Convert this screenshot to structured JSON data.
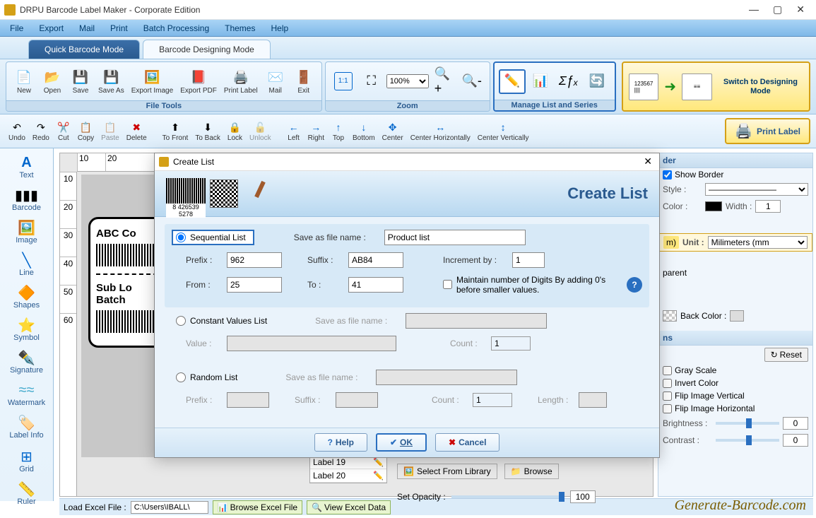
{
  "app": {
    "title": "DRPU Barcode Label Maker - Corporate Edition"
  },
  "menu": {
    "file": "File",
    "export": "Export",
    "mail": "Mail",
    "print": "Print",
    "batch": "Batch Processing",
    "themes": "Themes",
    "help": "Help"
  },
  "modes": {
    "quick": "Quick Barcode Mode",
    "designing": "Barcode Designing Mode"
  },
  "ribbon": {
    "file_tools": "File Tools",
    "new": "New",
    "open": "Open",
    "save": "Save",
    "save_as": "Save As",
    "export_image": "Export Image",
    "export_pdf": "Export PDF",
    "print_label": "Print Label",
    "mail": "Mail",
    "exit": "Exit",
    "zoom": "Zoom",
    "zoom_value": "100%",
    "manage": "Manage List and Series",
    "switch": "Switch to Designing Mode"
  },
  "toolbar2": {
    "undo": "Undo",
    "redo": "Redo",
    "cut": "Cut",
    "copy": "Copy",
    "paste": "Paste",
    "delete": "Delete",
    "to_front": "To Front",
    "to_back": "To Back",
    "lock": "Lock",
    "unlock": "Unlock",
    "left": "Left",
    "right": "Right",
    "top": "Top",
    "bottom": "Bottom",
    "center": "Center",
    "center_h": "Center Horizontally",
    "center_v": "Center Vertically",
    "print_label": "Print Label"
  },
  "palette": {
    "text": "Text",
    "barcode": "Barcode",
    "image": "Image",
    "line": "Line",
    "shapes": "Shapes",
    "symbol": "Symbol",
    "signature": "Signature",
    "watermark": "Watermark",
    "label_info": "Label Info",
    "grid": "Grid",
    "ruler": "Ruler"
  },
  "ruler_h": [
    "10",
    "20"
  ],
  "ruler_v": [
    "10",
    "20",
    "30",
    "40",
    "50",
    "60"
  ],
  "label": {
    "title": "ABC Co",
    "sub1": "Sub Lo",
    "sub2": "Batch"
  },
  "right": {
    "border_hdr": "der",
    "show_border": "Show Border",
    "style": "Style :",
    "color": "Color :",
    "width": "Width :",
    "width_val": "1",
    "unit_lbl": "Unit :",
    "unit_val": "Milimeters (mm",
    "parent": "parent",
    "back_color": "Back Color :",
    "options_hdr": "ns",
    "reset": "Reset",
    "gray_scale": "Gray Scale",
    "invert_color": "Invert Color",
    "flip_v": "Flip Image Vertical",
    "flip_h": "Flip Image Horizontal",
    "brightness": "Brightness :",
    "brightness_val": "0",
    "contrast": "Contrast :",
    "contrast_val": "0"
  },
  "label_list": [
    "Label 19",
    "Label 20"
  ],
  "lib_row": {
    "select": "Select From Library",
    "browse": "Browse"
  },
  "opacity": {
    "label": "Set Opacity :",
    "value": "100"
  },
  "bottom": {
    "load_excel": "Load Excel File :",
    "path": "C:\\Users\\IBALL\\",
    "browse": "Browse Excel File",
    "view": "View Excel Data"
  },
  "watermark": "Generate-Barcode.com",
  "dialog": {
    "title": "Create List",
    "header": "Create List",
    "hdr_bc_num": "8 426539 5278",
    "seq": "Sequential List",
    "save_as": "Save as file name :",
    "save_val": "Product list",
    "prefix_lbl": "Prefix :",
    "prefix_val": "962",
    "suffix_lbl": "Suffix :",
    "suffix_val": "AB84",
    "increment_lbl": "Increment by :",
    "increment_val": "1",
    "from_lbl": "From :",
    "from_val": "25",
    "to_lbl": "To :",
    "to_val": "41",
    "maintain": "Maintain number of Digits By adding 0's before smaller values.",
    "constant": "Constant Values List",
    "value_lbl": "Value :",
    "count_lbl": "Count :",
    "count_val": "1",
    "random": "Random List",
    "length_lbl": "Length :",
    "help": "Help",
    "ok": "OK",
    "cancel": "Cancel"
  }
}
